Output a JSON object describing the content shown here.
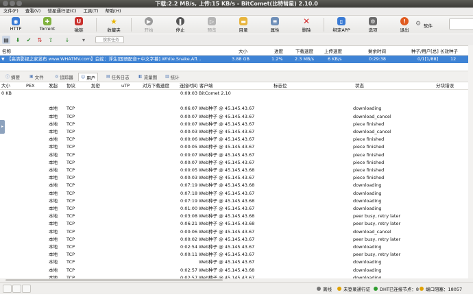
{
  "window": {
    "title": "下载:2.2 MB/s, 上传:15 KB/s - BitComet(比特彗星) 2.10.0"
  },
  "menu": [
    "文件(F)",
    "查看(V)",
    "彗星通行证(C)",
    "工具(T)",
    "帮助(H)"
  ],
  "toolbar": {
    "http": "HTTP",
    "torrent": "Torrent",
    "magnet": "磁链",
    "favorites": "收藏夹",
    "start": "开始",
    "stop": "停止",
    "preview": "预览",
    "folder": "目录",
    "properties": "属性",
    "delete": "删除",
    "bind_app": "绑定APP",
    "options": "选项",
    "exit": "退出",
    "software": "软件"
  },
  "search": {
    "placeholder": "搜索任务"
  },
  "task_columns": [
    "名称",
    "大小",
    "进度",
    "下载速度",
    "上传速度",
    "剩余时间",
    "种子/用户[总]",
    "长效种子"
  ],
  "task": {
    "name": "【高清影视之家发布 www.WHATMV.com】白蛇：浮生[国语配音+中文字幕].White.Snake.Afloat.20...",
    "size": "3.88 GB",
    "progress": "1.2%",
    "down": "2.3 MB/s",
    "up": "6 KB/s",
    "remaining": "0:29:38",
    "seeds": "0/1[1/88]",
    "longseed": "12"
  },
  "tabs": [
    "摘要",
    "文件",
    "追踪器",
    "用户",
    "任务日志",
    "流量图",
    "统计"
  ],
  "peer_columns": [
    "大小",
    "PEX",
    "发起",
    "协议",
    "加密",
    "uTP",
    "对方下载速度",
    "连接时间",
    "客户端",
    "标志位",
    "状态",
    "分块错误"
  ],
  "peers": [
    {
      "size": "0 KB",
      "src": "",
      "proto": "",
      "time": "0:09:03",
      "client": "BitComet 2.10",
      "state": ""
    },
    {
      "size": "",
      "src": "",
      "proto": "",
      "time": "",
      "client": "",
      "state": ""
    },
    {
      "size": "",
      "src": "本地",
      "proto": "TCP",
      "time": "0:06:07",
      "client": "Web种子 @ 45.145.43.67",
      "state": "downloading"
    },
    {
      "size": "",
      "src": "本地",
      "proto": "TCP",
      "time": "0:00:07",
      "client": "Web种子 @ 45.145.43.67",
      "state": "download_cancel"
    },
    {
      "size": "",
      "src": "本地",
      "proto": "TCP",
      "time": "0:00:07",
      "client": "Web种子 @ 45.145.43.67",
      "state": "piece finished"
    },
    {
      "size": "",
      "src": "本地",
      "proto": "TCP",
      "time": "0:00:03",
      "client": "Web种子 @ 45.145.43.67",
      "state": "download_cancel"
    },
    {
      "size": "",
      "src": "本地",
      "proto": "TCP",
      "time": "0:00:06",
      "client": "Web种子 @ 45.145.43.67",
      "state": "piece finished"
    },
    {
      "size": "",
      "src": "本地",
      "proto": "TCP",
      "time": "0:00:05",
      "client": "Web种子 @ 45.145.43.67",
      "state": "piece finished"
    },
    {
      "size": "",
      "src": "本地",
      "proto": "TCP",
      "time": "0:00:07",
      "client": "Web种子 @ 45.145.43.67",
      "state": "piece finished"
    },
    {
      "size": "",
      "src": "本地",
      "proto": "TCP",
      "time": "0:00:07",
      "client": "Web种子 @ 45.145.43.67",
      "state": "piece finished"
    },
    {
      "size": "",
      "src": "本地",
      "proto": "TCP",
      "time": "0:00:05",
      "client": "Web种子 @ 45.145.43.68",
      "state": "piece finished"
    },
    {
      "size": "",
      "src": "本地",
      "proto": "TCP",
      "time": "0:00:03",
      "client": "Web种子 @ 45.145.43.67",
      "state": "piece finished"
    },
    {
      "size": "",
      "src": "本地",
      "proto": "TCP",
      "time": "0:07:19",
      "client": "Web种子 @ 45.145.43.68",
      "state": "downloading"
    },
    {
      "size": "",
      "src": "本地",
      "proto": "TCP",
      "time": "0:07:18",
      "client": "Web种子 @ 45.145.43.67",
      "state": "downloading"
    },
    {
      "size": "",
      "src": "本地",
      "proto": "TCP",
      "time": "0:07:19",
      "client": "Web种子 @ 45.145.43.68",
      "state": "downloading"
    },
    {
      "size": "",
      "src": "本地",
      "proto": "TCP",
      "time": "0:01:00",
      "client": "Web种子 @ 45.145.43.67",
      "state": "downloading"
    },
    {
      "size": "",
      "src": "本地",
      "proto": "TCP",
      "time": "0:03:08",
      "client": "Web种子 @ 45.145.43.68",
      "state": "peer busy, retry later"
    },
    {
      "size": "",
      "src": "本地",
      "proto": "TCP",
      "time": "0:06:21",
      "client": "Web种子 @ 45.145.43.68",
      "state": "peer busy, retry later"
    },
    {
      "size": "",
      "src": "本地",
      "proto": "TCP",
      "time": "0:00:06",
      "client": "Web种子 @ 45.145.43.67",
      "state": "download_cancel"
    },
    {
      "size": "",
      "src": "本地",
      "proto": "TCP",
      "time": "0:00:02",
      "client": "Web种子 @ 45.145.43.67",
      "state": "peer busy, retry later"
    },
    {
      "size": "",
      "src": "本地",
      "proto": "TCP",
      "time": "0:02:54",
      "client": "Web种子 @ 45.145.43.67",
      "state": "downloading"
    },
    {
      "size": "",
      "src": "本地",
      "proto": "TCP",
      "time": "0:00:11",
      "client": "Web种子 @ 45.145.43.67",
      "state": "peer busy, retry later"
    },
    {
      "size": "",
      "src": "本地",
      "proto": "TCP",
      "time": "",
      "client": "Web种子 @ 45.145.43.67",
      "state": "downloading"
    },
    {
      "size": "",
      "src": "本地",
      "proto": "TCP",
      "time": "0:02:57",
      "client": "Web种子 @ 45.145.43.68",
      "state": "downloading"
    },
    {
      "size": "",
      "src": "本地",
      "proto": "TCP",
      "time": "0:02:57",
      "client": "Web种子 @ 45.145.43.67",
      "state": "downloading"
    }
  ],
  "status": {
    "offline": "离线",
    "not_logged": "未登录通行证",
    "dht": "DHT已连接节点：8",
    "port": "端口阻塞：18057"
  }
}
